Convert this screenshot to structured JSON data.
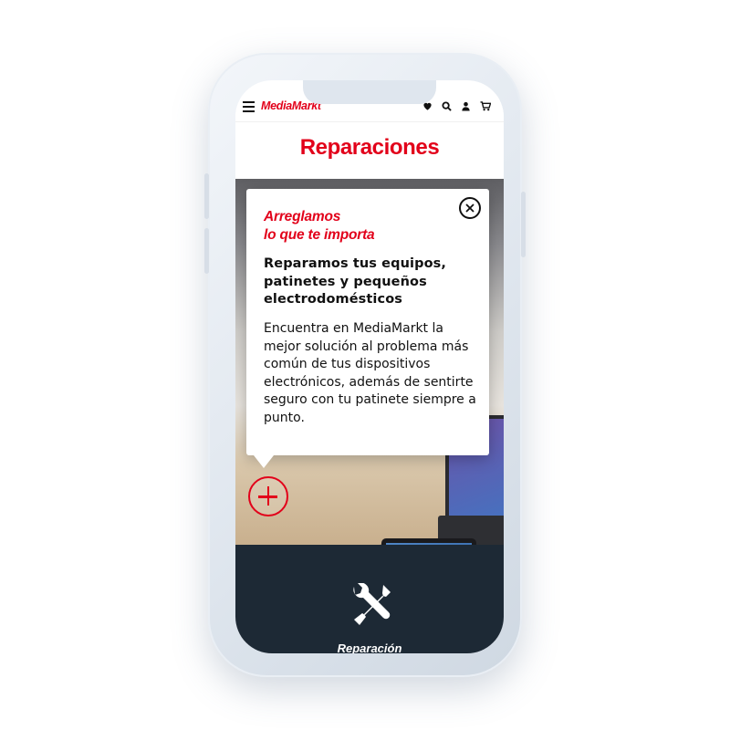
{
  "header": {
    "logo_text": "MediaMarkt",
    "icons": [
      "menu-icon",
      "heart-icon",
      "search-icon",
      "user-icon",
      "cart-icon"
    ]
  },
  "page": {
    "title": "Reparaciones"
  },
  "popup": {
    "heading": "Arreglamos\nlo que te importa",
    "subheading": "Reparamos tus equipos, patinetes y pequeños electrodomésticos",
    "body": "Encuentra en MediaMarkt la mejor solución al problema más común de tus dispositivos electrónicos, además de sentirte seguro con tu patinete siempre a punto."
  },
  "section": {
    "label": "Reparación",
    "icon": "tools-icon"
  },
  "colors": {
    "brand_red": "#e2001a",
    "dark_navy": "#1d2935"
  }
}
